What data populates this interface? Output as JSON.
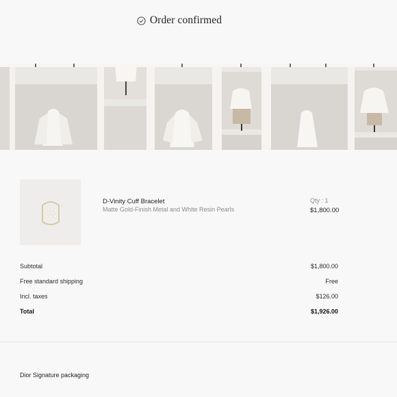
{
  "header": {
    "title": "Order confirmed",
    "icon": "check-circle-icon"
  },
  "hero": {
    "description_icon": "boutique-display-image"
  },
  "product": {
    "name": "D-Vinity Cuff Bracelet",
    "description": "Matte Gold-Finish Metal and White Resin Pearls",
    "quantity": "Qty : 1",
    "price": "$1,800.00",
    "image_icon": "bracelet-image"
  },
  "summary": {
    "subtotal_label": "Subtotal",
    "subtotal_value": "$1,800.00",
    "shipping_label": "Free standard shipping",
    "shipping_value": "Free",
    "taxes_label": "Incl. taxes",
    "taxes_value": "$126.00",
    "total_label": "Total",
    "total_value": "$1,926.00"
  },
  "packaging": {
    "label": "Dior Signature packaging"
  }
}
